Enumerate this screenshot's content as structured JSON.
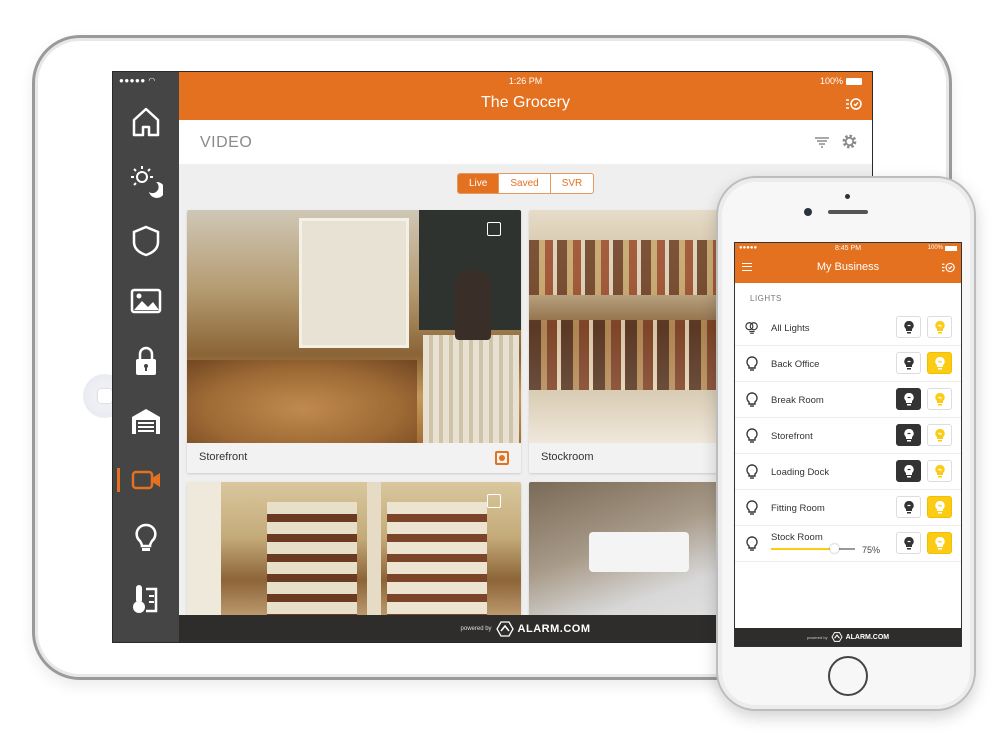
{
  "tablet": {
    "status": {
      "signal": "●●●●● ",
      "time": "1:26 PM",
      "battery": "100%"
    },
    "header": {
      "title": "The Grocery",
      "schedule_icon": "schedule-check-icon"
    },
    "sidebar": {
      "items": [
        {
          "name": "home",
          "icon": "home-icon"
        },
        {
          "name": "scenes",
          "icon": "sun-moon-icon"
        },
        {
          "name": "security",
          "icon": "shield-icon"
        },
        {
          "name": "images",
          "icon": "image-icon"
        },
        {
          "name": "locks",
          "icon": "lock-icon"
        },
        {
          "name": "garage",
          "icon": "garage-icon"
        },
        {
          "name": "video",
          "icon": "video-camera-icon",
          "active": true
        },
        {
          "name": "lights",
          "icon": "lightbulb-icon"
        },
        {
          "name": "thermostat",
          "icon": "thermostat-icon"
        }
      ]
    },
    "section_title": "VIDEO",
    "tabs": [
      {
        "label": "Live",
        "active": true
      },
      {
        "label": "Saved",
        "active": false
      },
      {
        "label": "SVR",
        "active": false
      }
    ],
    "cameras": [
      {
        "label": "Storefront",
        "recording": true
      },
      {
        "label": "Stockroom",
        "recording": false
      },
      {
        "label": "",
        "recording": false
      },
      {
        "label": "",
        "recording": false
      }
    ],
    "footer": {
      "powered_by": "powered by",
      "brand": "ALARM.COM"
    },
    "accent_color": "#e4711f"
  },
  "phone": {
    "status": {
      "signal": "●●●●● ",
      "time": "8:45 PM",
      "battery": "100%"
    },
    "header": {
      "title": "My Business"
    },
    "section": "LIGHTS",
    "lights": [
      {
        "name": "All Lights",
        "state": "none",
        "group": true
      },
      {
        "name": "Back Office",
        "state": "on"
      },
      {
        "name": "Break Room",
        "state": "off"
      },
      {
        "name": "Storefront",
        "state": "off"
      },
      {
        "name": "Loading Dock",
        "state": "off"
      },
      {
        "name": "Fitting Room",
        "state": "on"
      },
      {
        "name": "Stock Room",
        "state": "on",
        "dimmer": 75,
        "dimmer_label": "75%"
      }
    ],
    "footer": {
      "powered_by": "powered by",
      "brand": "ALARM.COM"
    },
    "on_color": "#fccb13"
  }
}
